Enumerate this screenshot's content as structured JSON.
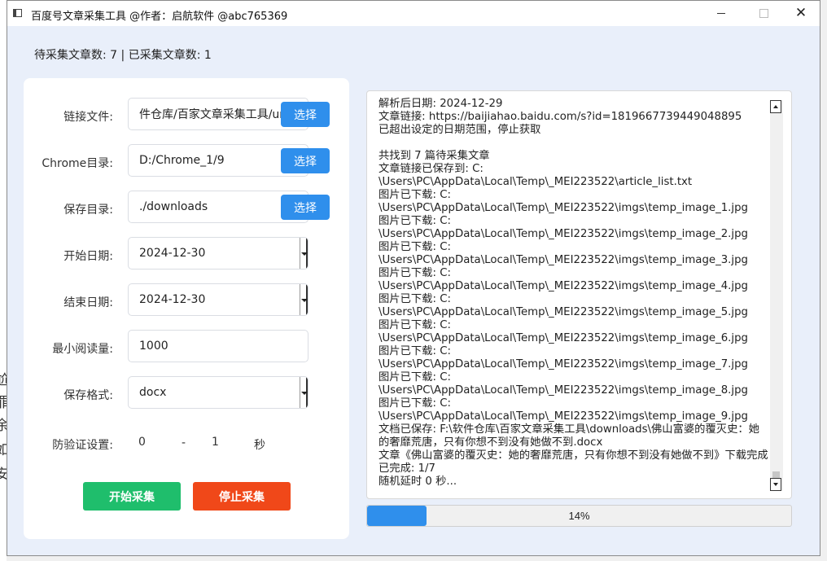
{
  "window": {
    "title": "百度号文章采集工具 @作者：启航软件 @abc765369"
  },
  "status": "待采集文章数: 7 | 已采集文章数: 1",
  "background_fragments": [
    "尬",
    "罪",
    "余",
    "如",
    "安"
  ],
  "form": {
    "link_file_label": "链接文件:",
    "link_file_value": "件仓库/百家文章采集工具/urls",
    "chrome_dir_label": "Chrome目录:",
    "chrome_dir_value": "D:/Chrome_1/9",
    "save_dir_label": "保存目录:",
    "save_dir_value": "./downloads",
    "choose_label": "选择",
    "start_date_label": "开始日期:",
    "start_date_value": "2024-12-30",
    "end_date_label": "结束日期:",
    "end_date_value": "2024-12-30",
    "min_reads_label": "最小阅读量:",
    "min_reads_value": "1000",
    "format_label": "保存格式:",
    "format_value": "docx",
    "anti_verify_label": "防验证设置:",
    "anti_verify_min": "0",
    "anti_verify_dash": "-",
    "anti_verify_max": "1",
    "anti_verify_unit": "秒"
  },
  "buttons": {
    "start": "开始采集",
    "stop": "停止采集"
  },
  "log": "解析后日期: 2024-12-29\n文章链接: https://baijiahao.baidu.com/s?id=1819667739449048895\n已超出设定的日期范围，停止获取\n\n共找到 7 篇待采集文章\n文章链接已保存到: C:\n\\Users\\PC\\AppData\\Local\\Temp\\_MEI223522\\article_list.txt\n图片已下载: C:\n\\Users\\PC\\AppData\\Local\\Temp\\_MEI223522\\imgs\\temp_image_1.jpg\n图片已下载: C:\n\\Users\\PC\\AppData\\Local\\Temp\\_MEI223522\\imgs\\temp_image_2.jpg\n图片已下载: C:\n\\Users\\PC\\AppData\\Local\\Temp\\_MEI223522\\imgs\\temp_image_3.jpg\n图片已下载: C:\n\\Users\\PC\\AppData\\Local\\Temp\\_MEI223522\\imgs\\temp_image_4.jpg\n图片已下载: C:\n\\Users\\PC\\AppData\\Local\\Temp\\_MEI223522\\imgs\\temp_image_5.jpg\n图片已下载: C:\n\\Users\\PC\\AppData\\Local\\Temp\\_MEI223522\\imgs\\temp_image_6.jpg\n图片已下载: C:\n\\Users\\PC\\AppData\\Local\\Temp\\_MEI223522\\imgs\\temp_image_7.jpg\n图片已下载: C:\n\\Users\\PC\\AppData\\Local\\Temp\\_MEI223522\\imgs\\temp_image_8.jpg\n图片已下载: C:\n\\Users\\PC\\AppData\\Local\\Temp\\_MEI223522\\imgs\\temp_image_9.jpg\n文档已保存: F:\\软件仓库\\百家文章采集工具\\downloads\\佛山富婆的覆灭史：她的奢靡荒唐，只有你想不到没有她做不到.docx\n文章《佛山富婆的覆灭史：她的奢靡荒唐，只有你想不到没有她做不到》下载完成\n已完成: 1/7\n随机延时 0 秒...",
  "progress": {
    "value": 0.14,
    "label": "14%"
  },
  "colors": {
    "accent": "#2f8fec",
    "start": "#1fbe6c",
    "stop": "#f04819",
    "window_bg": "#e9effa"
  }
}
